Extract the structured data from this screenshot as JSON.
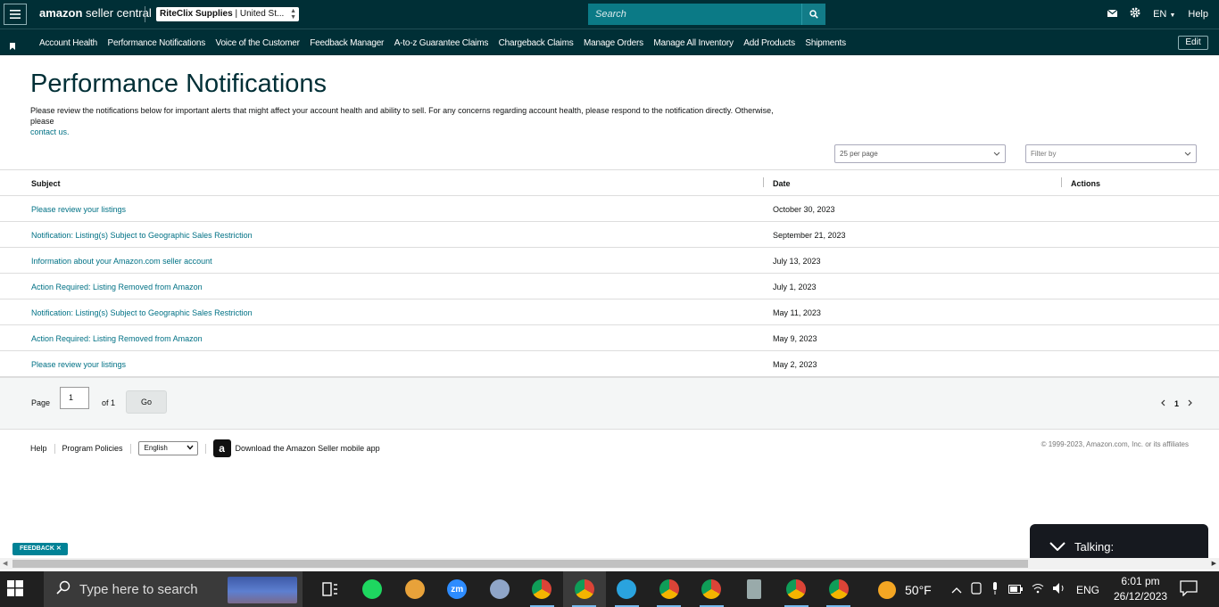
{
  "header": {
    "logo_bold": "amazon",
    "logo_rest": "seller central",
    "store_name": "RiteClix Supplies",
    "store_region": "United St...",
    "search_placeholder": "Search",
    "language": "EN",
    "help_label": "Help"
  },
  "nav": {
    "items": [
      "Account Health",
      "Performance Notifications",
      "Voice of the Customer",
      "Feedback Manager",
      "A-to-z Guarantee Claims",
      "Chargeback Claims",
      "Manage Orders",
      "Manage All Inventory",
      "Add Products",
      "Shipments"
    ],
    "edit_label": "Edit"
  },
  "page": {
    "title": "Performance Notifications",
    "description": "Please review the notifications below for important alerts that might affect your account health and ability to sell. For any concerns regarding account health, please respond to the notification directly. Otherwise, please",
    "contact_link": "contact us."
  },
  "controls": {
    "per_page": "25 per page",
    "filter_placeholder": "Filter by"
  },
  "table": {
    "columns": [
      "Subject",
      "Date",
      "Actions"
    ],
    "rows": [
      {
        "subject": "Please review your listings",
        "date": "October 30, 2023"
      },
      {
        "subject": "Notification: Listing(s) Subject to Geographic Sales Restriction",
        "date": "September 21, 2023"
      },
      {
        "subject": "Information about your Amazon.com seller account",
        "date": "July 13, 2023"
      },
      {
        "subject": "Action Required: Listing Removed from Amazon",
        "date": "July 1, 2023"
      },
      {
        "subject": "Notification: Listing(s) Subject to Geographic Sales Restriction",
        "date": "May 11, 2023"
      },
      {
        "subject": "Action Required: Listing Removed from Amazon",
        "date": "May 9, 2023"
      },
      {
        "subject": "Please review your listings",
        "date": "May 2, 2023"
      }
    ]
  },
  "pagination": {
    "page_label": "Page",
    "page_value": "1",
    "of_label": "of 1",
    "go_label": "Go",
    "current_page": "1"
  },
  "footer": {
    "help": "Help",
    "program_policies": "Program Policies",
    "language": "English",
    "app_text": "Download the Amazon Seller mobile app",
    "copyright": "© 1999-2023, Amazon.com, Inc. or its affiliates"
  },
  "feedback_label": "FEEDBACK ✕",
  "talking_label": "Talking:",
  "taskbar": {
    "search_placeholder": "Type here to search",
    "weather": "50°F",
    "lang": "ENG",
    "time": "6:01 pm",
    "date": "26/12/2023",
    "icons": [
      "task-view-icon",
      "spotify-icon",
      "app-icon",
      "zoom-icon",
      "satellite-icon",
      "chrome-icon",
      "chrome-l-icon",
      "telegram-icon",
      "chrome-m-icon",
      "chrome-m2-icon",
      "calculator-icon",
      "chrome-s-icon",
      "chrome-r-icon"
    ]
  }
}
